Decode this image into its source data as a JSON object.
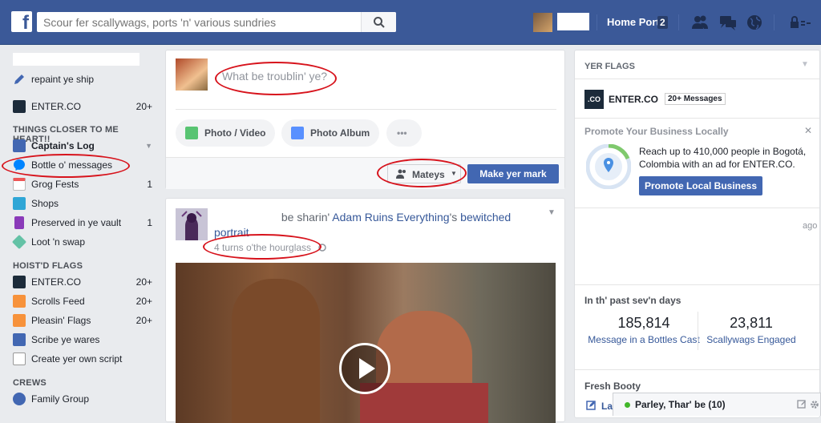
{
  "topbar": {
    "search_placeholder": "Scour fer scallywags, ports 'n' various sundries",
    "home_label": "Home Port",
    "home_count": "2",
    "colors": {
      "brand": "#3b5998",
      "brand_dark": "#29487d"
    }
  },
  "leftnav": {
    "edit_label": "repaint ye ship",
    "pages_shortcut": {
      "label": "ENTER.CO",
      "count": "20+"
    },
    "section_favorites": "THINGS CLOSER TO ME HEART!!",
    "favorites": [
      {
        "label": "Captain's Log",
        "count": ""
      },
      {
        "label": "Bottle o' messages",
        "count": ""
      },
      {
        "label": "Grog Fests",
        "count": "1"
      },
      {
        "label": "Shops",
        "count": ""
      },
      {
        "label": "Preserved in ye vault",
        "count": "1"
      },
      {
        "label": "Loot 'n swap",
        "count": ""
      }
    ],
    "section_pages": "HOIST'D FLAGS",
    "pages": [
      {
        "label": "ENTER.CO",
        "count": "20+"
      },
      {
        "label": "Scrolls Feed",
        "count": "20+"
      },
      {
        "label": "Pleasin' Flags",
        "count": "20+"
      },
      {
        "label": "Scribe ye wares",
        "count": ""
      },
      {
        "label": "Create yer own script",
        "count": ""
      }
    ],
    "section_groups": "CREWS",
    "groups": [
      {
        "label": "Family Group"
      }
    ]
  },
  "composer": {
    "prompt": "What be troublin' ye?",
    "photo_video_label": "Photo / Video",
    "photo_album_label": "Photo Album",
    "more_label": "•••",
    "audience_label": "Mateys",
    "post_label": "Make yer mark"
  },
  "post": {
    "action_text": "be sharin'",
    "page_name": "Adam Ruins Everything",
    "possessive": "'s",
    "object_text": "bewitched",
    "object_text2": "portrait",
    "time": "4 turns o'the hourglass"
  },
  "rightcol": {
    "pages_header": "YER FLAGS",
    "page_logo": ".CO",
    "page_name": "ENTER.CO",
    "messages_badge": "20+ Messages",
    "promo_title": "Promote Your Business Locally",
    "promo_text": "Reach up to 410,000 people in Bogotá, Colombia with an ad for ENTER.CO.",
    "promo_button": "Promote Local Business",
    "ago_text": "ago",
    "week_header": "In th' past sev'n days",
    "stats": [
      {
        "value": "185,814",
        "label": "Message in a Bottles Cast"
      },
      {
        "value": "23,811",
        "label": "Scallywags Engaged"
      }
    ],
    "booty_header": "Fresh Booty",
    "booty_item": "La"
  },
  "chat": {
    "label": "Parley, Thar' be (10)"
  }
}
